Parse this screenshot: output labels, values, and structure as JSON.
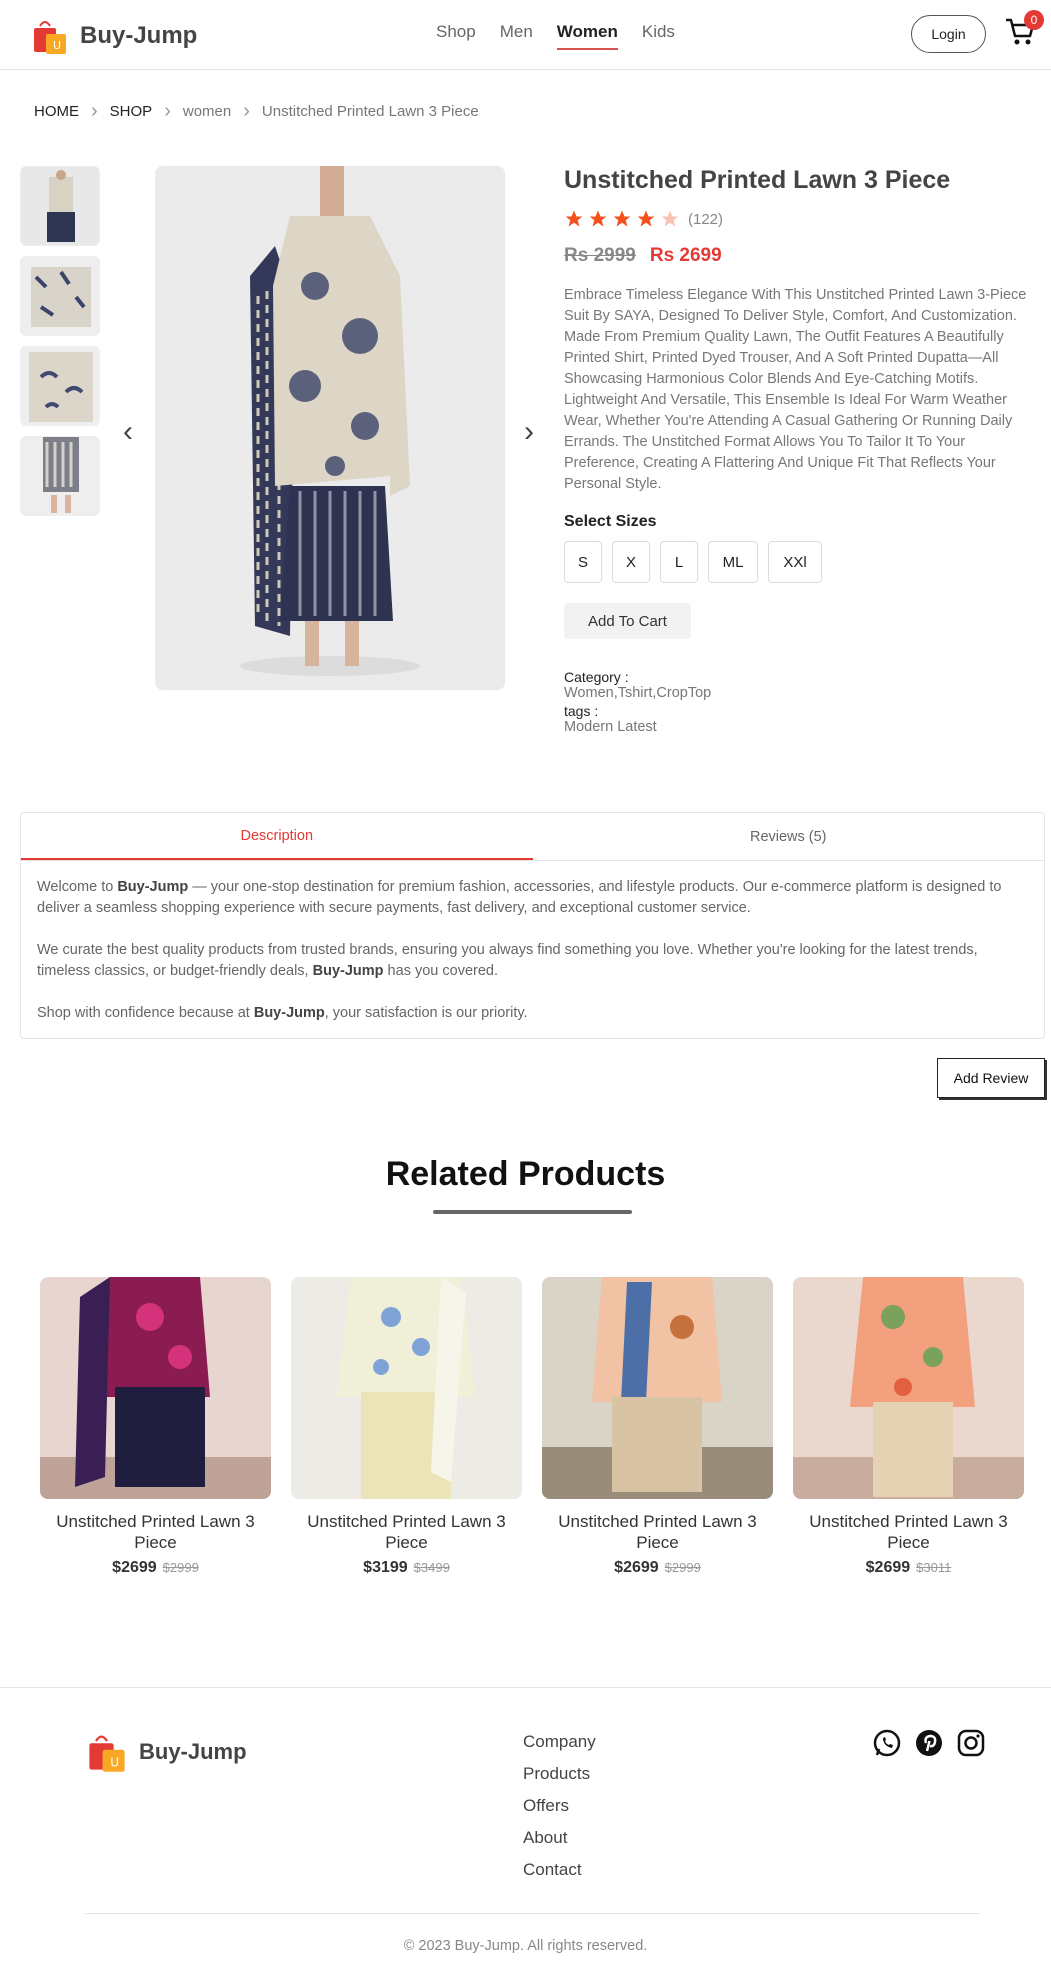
{
  "header": {
    "brand": "Buy-Jump",
    "nav": [
      "Shop",
      "Men",
      "Women",
      "Kids"
    ],
    "active_nav": "Women",
    "login_label": "Login",
    "cart_count": "0"
  },
  "breadcrumb": {
    "home": "HOME",
    "shop": "SHOP",
    "category": "women",
    "current": "Unstitched Printed Lawn 3 Piece"
  },
  "product": {
    "title": "Unstitched Printed Lawn 3 Piece",
    "rating": 4,
    "rating_count": "(122)",
    "old_price": "Rs 2999",
    "new_price": "Rs 2699",
    "description": "Embrace Timeless Elegance With This Unstitched Printed Lawn 3-Piece Suit By SAYA, Designed To Deliver Style, Comfort, And Customization. Made From Premium Quality Lawn, The Outfit Features A Beautifully Printed Shirt, Printed Dyed Trouser, And A Soft Printed Dupatta—All Showcasing Harmonious Color Blends And Eye-Catching Motifs. Lightweight And Versatile, This Ensemble Is Ideal For Warm Weather Wear, Whether You're Attending A Casual Gathering Or Running Daily Errands. The Unstitched Format Allows You To Tailor It To Your Preference, Creating A Flattering And Unique Fit That Reflects Your Personal Style.",
    "sizes_label": "Select Sizes",
    "sizes": [
      "S",
      "X",
      "L",
      "ML",
      "XXl"
    ],
    "add_to_cart": "Add To Cart",
    "category_label": "Category :",
    "category_value": "Women,Tshirt,CropTop",
    "tags_label": "tags :",
    "tags_value": "Modern Latest"
  },
  "tabs": {
    "description": "Description",
    "reviews": "Reviews (5)",
    "content": {
      "p1_pre": "Welcome to ",
      "p1_brand": "Buy-Jump",
      "p1_post": " — your one-stop destination for premium fashion, accessories, and lifestyle products. Our e-commerce platform is designed to deliver a seamless shopping experience with secure payments, fast delivery, and exceptional customer service.",
      "p2_pre": "We curate the best quality products from trusted brands, ensuring you always find something you love. Whether you're looking for the latest trends, timeless classics, or budget-friendly deals, ",
      "p2_brand": "Buy-Jump",
      "p2_post": " has you covered.",
      "p3_pre": "Shop with confidence because at ",
      "p3_brand": "Buy-Jump",
      "p3_post": ", your satisfaction is our priority."
    }
  },
  "add_review": "Add Review",
  "related": {
    "title": "Related Products",
    "items": [
      {
        "name": "Unstitched Printed Lawn 3 Piece",
        "price": "$2699",
        "old": "$2999"
      },
      {
        "name": "Unstitched Printed Lawn 3 Piece",
        "price": "$3199",
        "old": "$3499"
      },
      {
        "name": "Unstitched Printed Lawn 3 Piece",
        "price": "$2699",
        "old": "$2999"
      },
      {
        "name": "Unstitched Printed Lawn 3 Piece",
        "price": "$2699",
        "old": "$3011"
      }
    ]
  },
  "footer": {
    "brand": "Buy-Jump",
    "links": [
      "Company",
      "Products",
      "Offers",
      "About",
      "Contact"
    ],
    "socials": [
      "whatsapp-icon",
      "pinterest-icon",
      "instagram-icon"
    ],
    "copyright": "© 2023 Buy-Jump. All rights reserved."
  },
  "colors": {
    "accent": "#e53935",
    "star": "#f4511e"
  }
}
